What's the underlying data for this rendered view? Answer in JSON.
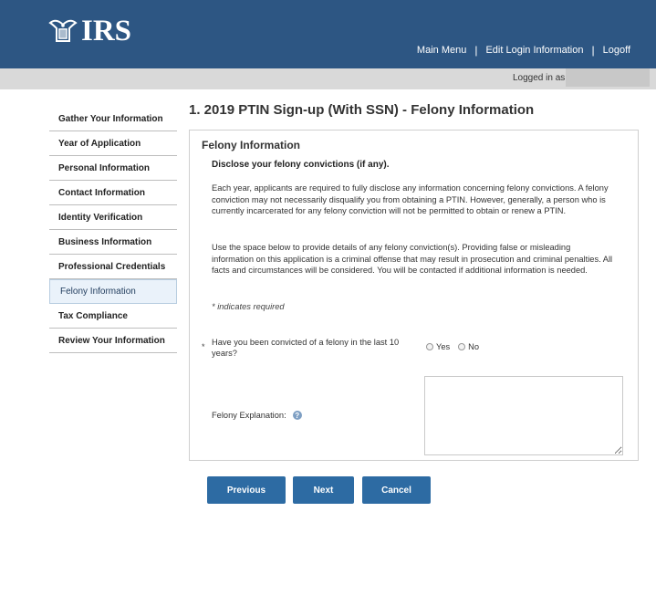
{
  "header": {
    "logo_text": "IRS",
    "nav": [
      {
        "label": "Main Menu"
      },
      {
        "label": "Edit Login Information"
      },
      {
        "label": "Logoff"
      }
    ],
    "separator": "|",
    "logged_in_label": "Logged in as (",
    "colors": {
      "header_bg": "#2d5683",
      "subbar_bg": "#d9d9d9"
    }
  },
  "sidebar": {
    "items": [
      {
        "label": "Gather Your Information"
      },
      {
        "label": "Year of Application"
      },
      {
        "label": "Personal Information"
      },
      {
        "label": "Contact Information"
      },
      {
        "label": "Identity Verification"
      },
      {
        "label": "Business Information"
      },
      {
        "label": "Professional Credentials"
      },
      {
        "label": "Felony Information",
        "active": true
      },
      {
        "label": "Tax Compliance"
      },
      {
        "label": "Review Your Information"
      }
    ]
  },
  "main": {
    "page_title": "1. 2019 PTIN Sign-up (With SSN) - Felony Information",
    "panel_title": "Felony Information",
    "disclose": "Disclose your felony convictions (if any).",
    "para1": "Each year, applicants are required to fully disclose any information concerning felony convictions. A felony conviction may not necessarily disqualify you from obtaining a PTIN. However, generally, a person who is currently incarcerated for any felony conviction will not be permitted to obtain or renew a PTIN.",
    "para2": "Use the space below to provide details of any felony conviction(s). Providing false or misleading information on this application is a criminal offense that may result in prosecution and criminal penalties. All facts and circumstances will be considered. You will be contacted if additional information is needed.",
    "required_note": "* indicates required",
    "question": {
      "required_mark": "*",
      "text": "Have you been convicted of a felony in the last 10 years?",
      "options": [
        "Yes",
        "No"
      ]
    },
    "explanation": {
      "label": "Felony Explanation:",
      "help_glyph": "?",
      "value": ""
    }
  },
  "actions": {
    "previous": "Previous",
    "next": "Next",
    "cancel": "Cancel",
    "button_color": "#2d6ba3"
  }
}
